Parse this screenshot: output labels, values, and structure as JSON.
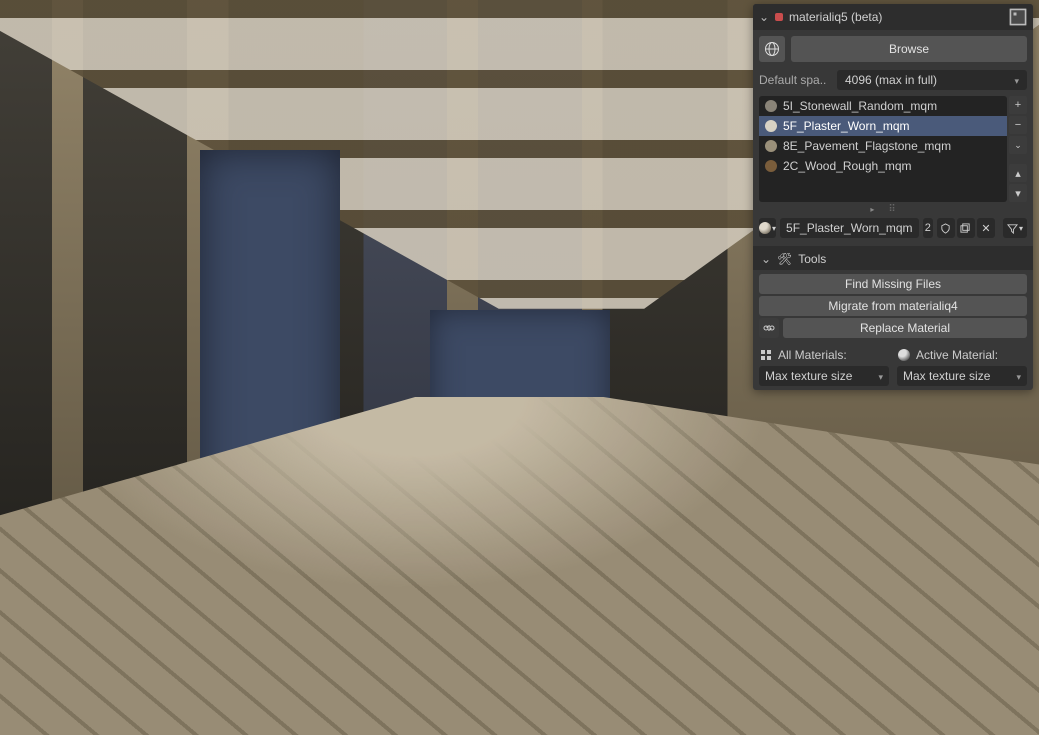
{
  "panel": {
    "title": "materialiq5 (beta)",
    "browse_label": "Browse",
    "default_space_label": "Default spa..",
    "resolution_value": "4096 (max in full)",
    "materials": [
      {
        "name": "5I_Stonewall_Random_mqm",
        "swatch": "#8a8478"
      },
      {
        "name": "5F_Plaster_Worn_mqm",
        "swatch": "#d8d2c4",
        "selected": true
      },
      {
        "name": "8E_Pavement_Flagstone_mqm",
        "swatch": "#9a907a"
      },
      {
        "name": "2C_Wood_Rough_mqm",
        "swatch": "#7a5d3b"
      }
    ],
    "active_material": {
      "name": "5F_Plaster_Worn_mqm",
      "users": "2"
    },
    "tools": {
      "header": "Tools",
      "find_missing": "Find Missing Files",
      "migrate": "Migrate from materialiq4",
      "replace": "Replace Material"
    },
    "columns": {
      "all_label": "All Materials:",
      "active_label": "Active Material:",
      "all_dd": "Max texture size",
      "active_dd": "Max texture size"
    }
  }
}
